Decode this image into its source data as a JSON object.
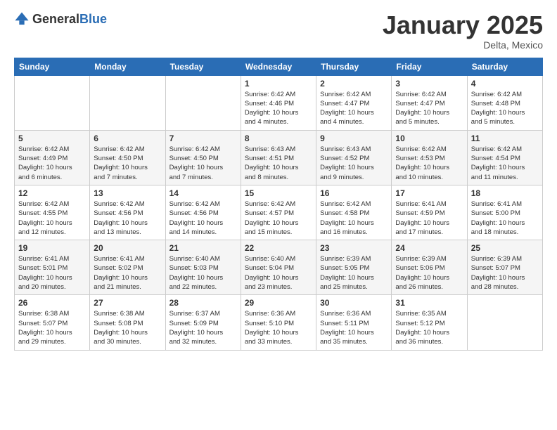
{
  "header": {
    "logo_general": "General",
    "logo_blue": "Blue",
    "month_title": "January 2025",
    "location": "Delta, Mexico"
  },
  "weekdays": [
    "Sunday",
    "Monday",
    "Tuesday",
    "Wednesday",
    "Thursday",
    "Friday",
    "Saturday"
  ],
  "weeks": [
    [
      {
        "day": "",
        "info": ""
      },
      {
        "day": "",
        "info": ""
      },
      {
        "day": "",
        "info": ""
      },
      {
        "day": "1",
        "info": "Sunrise: 6:42 AM\nSunset: 4:46 PM\nDaylight: 10 hours\nand 4 minutes."
      },
      {
        "day": "2",
        "info": "Sunrise: 6:42 AM\nSunset: 4:47 PM\nDaylight: 10 hours\nand 4 minutes."
      },
      {
        "day": "3",
        "info": "Sunrise: 6:42 AM\nSunset: 4:47 PM\nDaylight: 10 hours\nand 5 minutes."
      },
      {
        "day": "4",
        "info": "Sunrise: 6:42 AM\nSunset: 4:48 PM\nDaylight: 10 hours\nand 5 minutes."
      }
    ],
    [
      {
        "day": "5",
        "info": "Sunrise: 6:42 AM\nSunset: 4:49 PM\nDaylight: 10 hours\nand 6 minutes."
      },
      {
        "day": "6",
        "info": "Sunrise: 6:42 AM\nSunset: 4:50 PM\nDaylight: 10 hours\nand 7 minutes."
      },
      {
        "day": "7",
        "info": "Sunrise: 6:42 AM\nSunset: 4:50 PM\nDaylight: 10 hours\nand 7 minutes."
      },
      {
        "day": "8",
        "info": "Sunrise: 6:43 AM\nSunset: 4:51 PM\nDaylight: 10 hours\nand 8 minutes."
      },
      {
        "day": "9",
        "info": "Sunrise: 6:43 AM\nSunset: 4:52 PM\nDaylight: 10 hours\nand 9 minutes."
      },
      {
        "day": "10",
        "info": "Sunrise: 6:42 AM\nSunset: 4:53 PM\nDaylight: 10 hours\nand 10 minutes."
      },
      {
        "day": "11",
        "info": "Sunrise: 6:42 AM\nSunset: 4:54 PM\nDaylight: 10 hours\nand 11 minutes."
      }
    ],
    [
      {
        "day": "12",
        "info": "Sunrise: 6:42 AM\nSunset: 4:55 PM\nDaylight: 10 hours\nand 12 minutes."
      },
      {
        "day": "13",
        "info": "Sunrise: 6:42 AM\nSunset: 4:56 PM\nDaylight: 10 hours\nand 13 minutes."
      },
      {
        "day": "14",
        "info": "Sunrise: 6:42 AM\nSunset: 4:56 PM\nDaylight: 10 hours\nand 14 minutes."
      },
      {
        "day": "15",
        "info": "Sunrise: 6:42 AM\nSunset: 4:57 PM\nDaylight: 10 hours\nand 15 minutes."
      },
      {
        "day": "16",
        "info": "Sunrise: 6:42 AM\nSunset: 4:58 PM\nDaylight: 10 hours\nand 16 minutes."
      },
      {
        "day": "17",
        "info": "Sunrise: 6:41 AM\nSunset: 4:59 PM\nDaylight: 10 hours\nand 17 minutes."
      },
      {
        "day": "18",
        "info": "Sunrise: 6:41 AM\nSunset: 5:00 PM\nDaylight: 10 hours\nand 18 minutes."
      }
    ],
    [
      {
        "day": "19",
        "info": "Sunrise: 6:41 AM\nSunset: 5:01 PM\nDaylight: 10 hours\nand 20 minutes."
      },
      {
        "day": "20",
        "info": "Sunrise: 6:41 AM\nSunset: 5:02 PM\nDaylight: 10 hours\nand 21 minutes."
      },
      {
        "day": "21",
        "info": "Sunrise: 6:40 AM\nSunset: 5:03 PM\nDaylight: 10 hours\nand 22 minutes."
      },
      {
        "day": "22",
        "info": "Sunrise: 6:40 AM\nSunset: 5:04 PM\nDaylight: 10 hours\nand 23 minutes."
      },
      {
        "day": "23",
        "info": "Sunrise: 6:39 AM\nSunset: 5:05 PM\nDaylight: 10 hours\nand 25 minutes."
      },
      {
        "day": "24",
        "info": "Sunrise: 6:39 AM\nSunset: 5:06 PM\nDaylight: 10 hours\nand 26 minutes."
      },
      {
        "day": "25",
        "info": "Sunrise: 6:39 AM\nSunset: 5:07 PM\nDaylight: 10 hours\nand 28 minutes."
      }
    ],
    [
      {
        "day": "26",
        "info": "Sunrise: 6:38 AM\nSunset: 5:07 PM\nDaylight: 10 hours\nand 29 minutes."
      },
      {
        "day": "27",
        "info": "Sunrise: 6:38 AM\nSunset: 5:08 PM\nDaylight: 10 hours\nand 30 minutes."
      },
      {
        "day": "28",
        "info": "Sunrise: 6:37 AM\nSunset: 5:09 PM\nDaylight: 10 hours\nand 32 minutes."
      },
      {
        "day": "29",
        "info": "Sunrise: 6:36 AM\nSunset: 5:10 PM\nDaylight: 10 hours\nand 33 minutes."
      },
      {
        "day": "30",
        "info": "Sunrise: 6:36 AM\nSunset: 5:11 PM\nDaylight: 10 hours\nand 35 minutes."
      },
      {
        "day": "31",
        "info": "Sunrise: 6:35 AM\nSunset: 5:12 PM\nDaylight: 10 hours\nand 36 minutes."
      },
      {
        "day": "",
        "info": ""
      }
    ]
  ]
}
